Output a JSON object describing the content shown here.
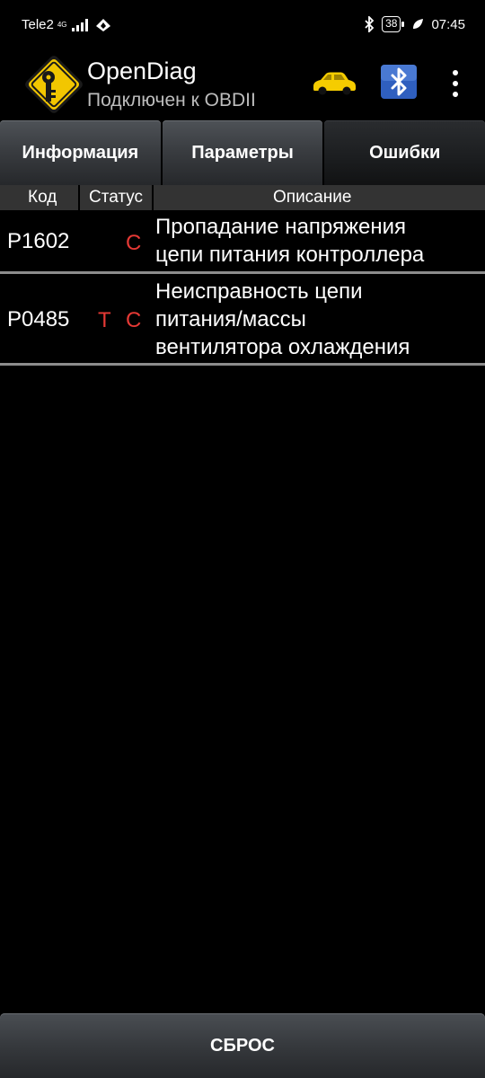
{
  "status_bar": {
    "carrier": "Tele2",
    "network": "4G",
    "battery": "38",
    "time": "07:45"
  },
  "app": {
    "title": "OpenDiag",
    "subtitle": "Подключен к OBDII"
  },
  "tabs": [
    {
      "label": "Информация",
      "active": false
    },
    {
      "label": "Параметры",
      "active": false
    },
    {
      "label": "Ошибки",
      "active": true
    }
  ],
  "columns": {
    "code": "Код",
    "status": "Статус",
    "description": "Описание"
  },
  "errors": [
    {
      "code": "P1602",
      "status_t": "",
      "status_c": "С",
      "description_lines": [
        "Пропадание напряжения",
        "цепи питания контроллера"
      ]
    },
    {
      "code": "P0485",
      "status_t": "Т",
      "status_c": "С",
      "description_lines": [
        "Неисправность цепи",
        "питания/массы",
        "вентилятора охлаждения"
      ]
    }
  ],
  "reset_button": "СБРОС",
  "colors": {
    "status_red": "#e53935",
    "car_yellow": "#f5cc00",
    "background": "#000000"
  },
  "icons": [
    "key-sign-logo-icon",
    "car-icon",
    "bluetooth-icon",
    "more-vert-icon",
    "wifi-icon",
    "leaf-icon"
  ]
}
